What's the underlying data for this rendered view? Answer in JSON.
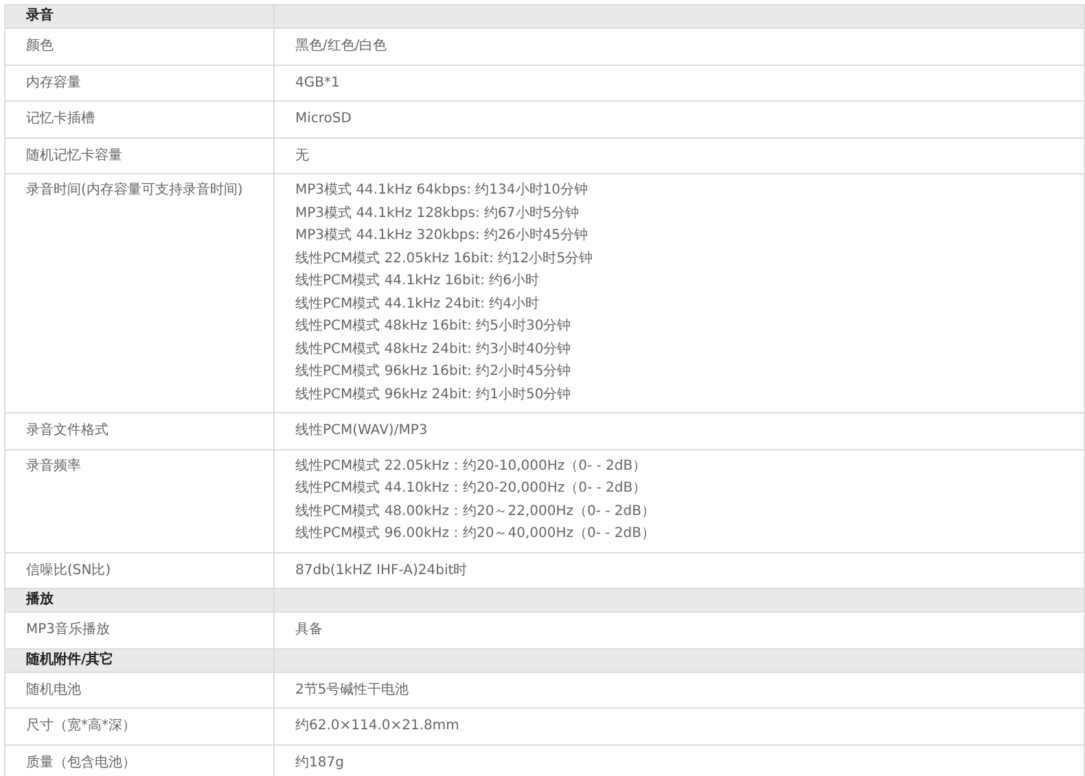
{
  "sections": [
    {
      "title": "录音",
      "rows": [
        {
          "label": "颜色",
          "values": [
            "黑色/红色/白色"
          ]
        },
        {
          "label": "内存容量",
          "values": [
            "4GB*1"
          ]
        },
        {
          "label": "记忆卡插槽",
          "values": [
            "MicroSD"
          ]
        },
        {
          "label": "随机记忆卡容量",
          "values": [
            "无"
          ]
        },
        {
          "label": "录音时间(内存容量可支持录音时间)",
          "values": [
            "MP3模式 44.1kHz 64kbps: 约134小时10分钟",
            "MP3模式 44.1kHz 128kbps: 约67小时5分钟",
            "MP3模式 44.1kHz 320kbps: 约26小时45分钟",
            "线性PCM模式 22.05kHz 16bit: 约12小时5分钟",
            "线性PCM模式 44.1kHz 16bit: 约6小时",
            "线性PCM模式 44.1kHz 24bit: 约4小时",
            "线性PCM模式 48kHz 16bit: 约5小时30分钟",
            "线性PCM模式 48kHz 24bit: 约3小时40分钟",
            "线性PCM模式 96kHz 16bit: 约2小时45分钟",
            "线性PCM模式 96kHz 24bit: 约1小时50分钟"
          ]
        },
        {
          "label": "录音文件格式",
          "values": [
            "线性PCM(WAV)/MP3"
          ]
        },
        {
          "label": "录音频率",
          "values": [
            "线性PCM模式 22.05kHz：约20-10,000Hz（0- - 2dB）",
            "线性PCM模式 44.10kHz：约20-20,000Hz（0- - 2dB）",
            "线性PCM模式 48.00kHz：约20～22,000Hz（0- - 2dB）",
            "线性PCM模式 96.00kHz：约20～40,000Hz（0- - 2dB）"
          ]
        },
        {
          "label": "信噪比(SN比)",
          "values": [
            "87db(1kHZ IHF-A)24bit时"
          ]
        }
      ]
    },
    {
      "title": "播放",
      "rows": [
        {
          "label": "MP3音乐播放",
          "values": [
            "具备"
          ]
        }
      ]
    },
    {
      "title": "随机附件/其它",
      "rows": [
        {
          "label": "随机电池",
          "values": [
            "2节5号碱性干电池"
          ]
        },
        {
          "label": "尺寸（宽*高*深）",
          "values": [
            "约62.0×114.0×21.8mm"
          ]
        },
        {
          "label": "质量（包含电池）",
          "values": [
            "约187g"
          ]
        }
      ]
    }
  ]
}
